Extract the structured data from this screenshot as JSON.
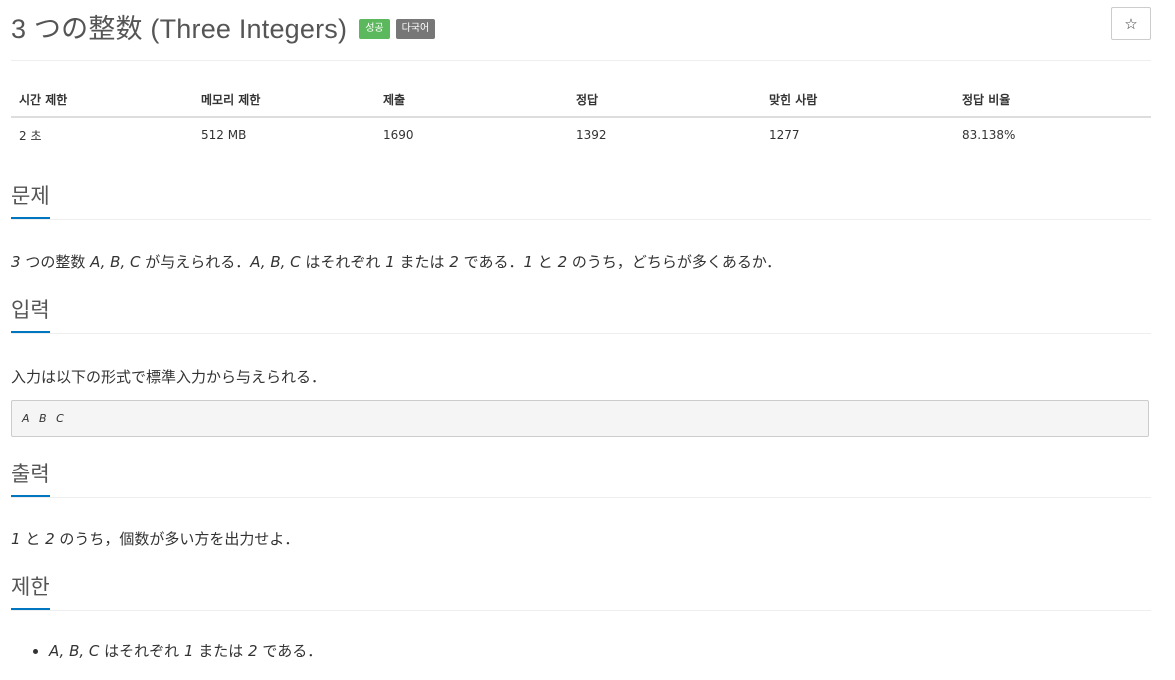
{
  "problem": {
    "title": "3 つの整数 (Three Integers)",
    "badges": [
      "성공",
      "다국어"
    ],
    "star_icon": "star-outline-icon"
  },
  "stats": {
    "headers": [
      "시간 제한",
      "메모리 제한",
      "제출",
      "정답",
      "맞힌 사람",
      "정답 비율"
    ],
    "values": [
      "2 초",
      "512 MB",
      "1690",
      "1392",
      "1277",
      "83.138%"
    ]
  },
  "sections": {
    "description": {
      "heading": "문제",
      "text": {
        "n3": "3",
        "t1": " つの整数 ",
        "vars": "A, B, C",
        "t2": " が与えられる．",
        "vars2": "A, B, C",
        "t3": " はそれぞれ ",
        "one": "1",
        "t4": " または ",
        "two": "2",
        "t5": " である．",
        "one2": "1",
        "t6": " と ",
        "two2": "2",
        "t7": " のうち，どちらが多くあるか．"
      }
    },
    "input": {
      "heading": "입력",
      "text": "入力は以下の形式で標準入力から与えられる．",
      "format": "A B C"
    },
    "output": {
      "heading": "출력",
      "text": {
        "one": "1",
        "t1": " と ",
        "two": "2",
        "t2": " のうち，個数が多い方を出力せよ．"
      }
    },
    "limits": {
      "heading": "제한",
      "item": {
        "vars": "A, B, C",
        "t1": " はそれぞれ ",
        "one": "1",
        "t2": " または ",
        "two": "2",
        "t3": " である．"
      }
    }
  },
  "colors": {
    "accent": "#0076c0",
    "success_badge": "#5cb85c",
    "multilang_badge": "#777777"
  }
}
